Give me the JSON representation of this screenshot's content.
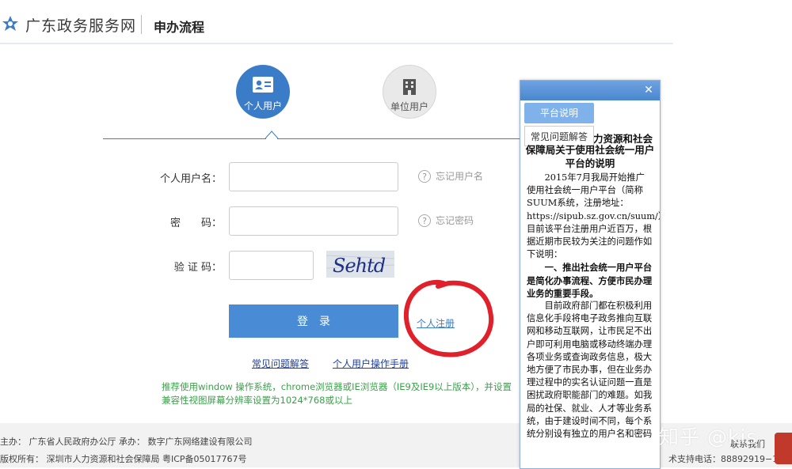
{
  "header": {
    "site_title": "广东政务服务网",
    "page_title": "申办流程"
  },
  "tabs": {
    "personal": "个人用户",
    "company": "单位用户"
  },
  "form": {
    "username_label": "个人用户名：",
    "password_label": "密　　码：",
    "captcha_label": "验 证 码：",
    "captcha_text": "Sehtd",
    "forgot_username": "忘记用户名",
    "forgot_password": "忘记密码",
    "help_mark": "?",
    "login_label": "登录",
    "register_link": "个人注册",
    "faq_link": "常见问题解答",
    "manual_link": "个人用户操作手册",
    "browser_note": "推荐使用window 操作系统，chrome浏览器或IE浏览器（IE9及IE9以上版本），并设置兼容性视图屏幕分辨率设置为1024*768或以上"
  },
  "footer": {
    "host": "主办：  广东省人民政府办公厅      承办：  数字广东网络建设有限公司",
    "org": "版权所有：  深圳市人力资源和社会保障局      粤ICP备05017767号",
    "support": "术支持电话：88892919−1",
    "contact": "联系我们"
  },
  "panel": {
    "close": "✕",
    "tab_platform": "平台说明",
    "tab_faq": "常见问题解答",
    "title_line1": "力资源和社会",
    "title_rest": "保障局关于使用社会统一用户平台的说明",
    "para1": "2015年7月我局开始推广使用社会统一用户平台（简称SUUM系统，注册地址：https://sipub.sz.gov.cn/suum/），目前该平台注册用户近百万，根据近期市民较为关注的问题作如下说明：",
    "para2": "一、推出社会统一用户平台是简化办事流程、方便市民办理业务的重要手段。",
    "para3": "目前政府部门都在积极利用信息化手段将电子政务推向互联网和移动互联网，让市民足不出户即可利用电脑或移动终端办理各项业务或查询政务信息，极大地方便了市民办事，但在业务办理过程中的实名认证问题一直是困扰政府职能部门的难题。如我局的社保、就业、人才等业务系统，由于建设时间不同，每个系统分别设有独立的用户名和密码"
  },
  "watermark": "知乎 @kis",
  "colors": {
    "primary": "#3a7cc7",
    "button": "#4a8bd6",
    "note_green": "#3aa14a",
    "link_dark": "#1f3fa0",
    "annotation_red": "#e0202a"
  },
  "icons": [
    "government-logo-icon",
    "id-card-icon",
    "building-icon",
    "question-icon",
    "close-icon"
  ]
}
